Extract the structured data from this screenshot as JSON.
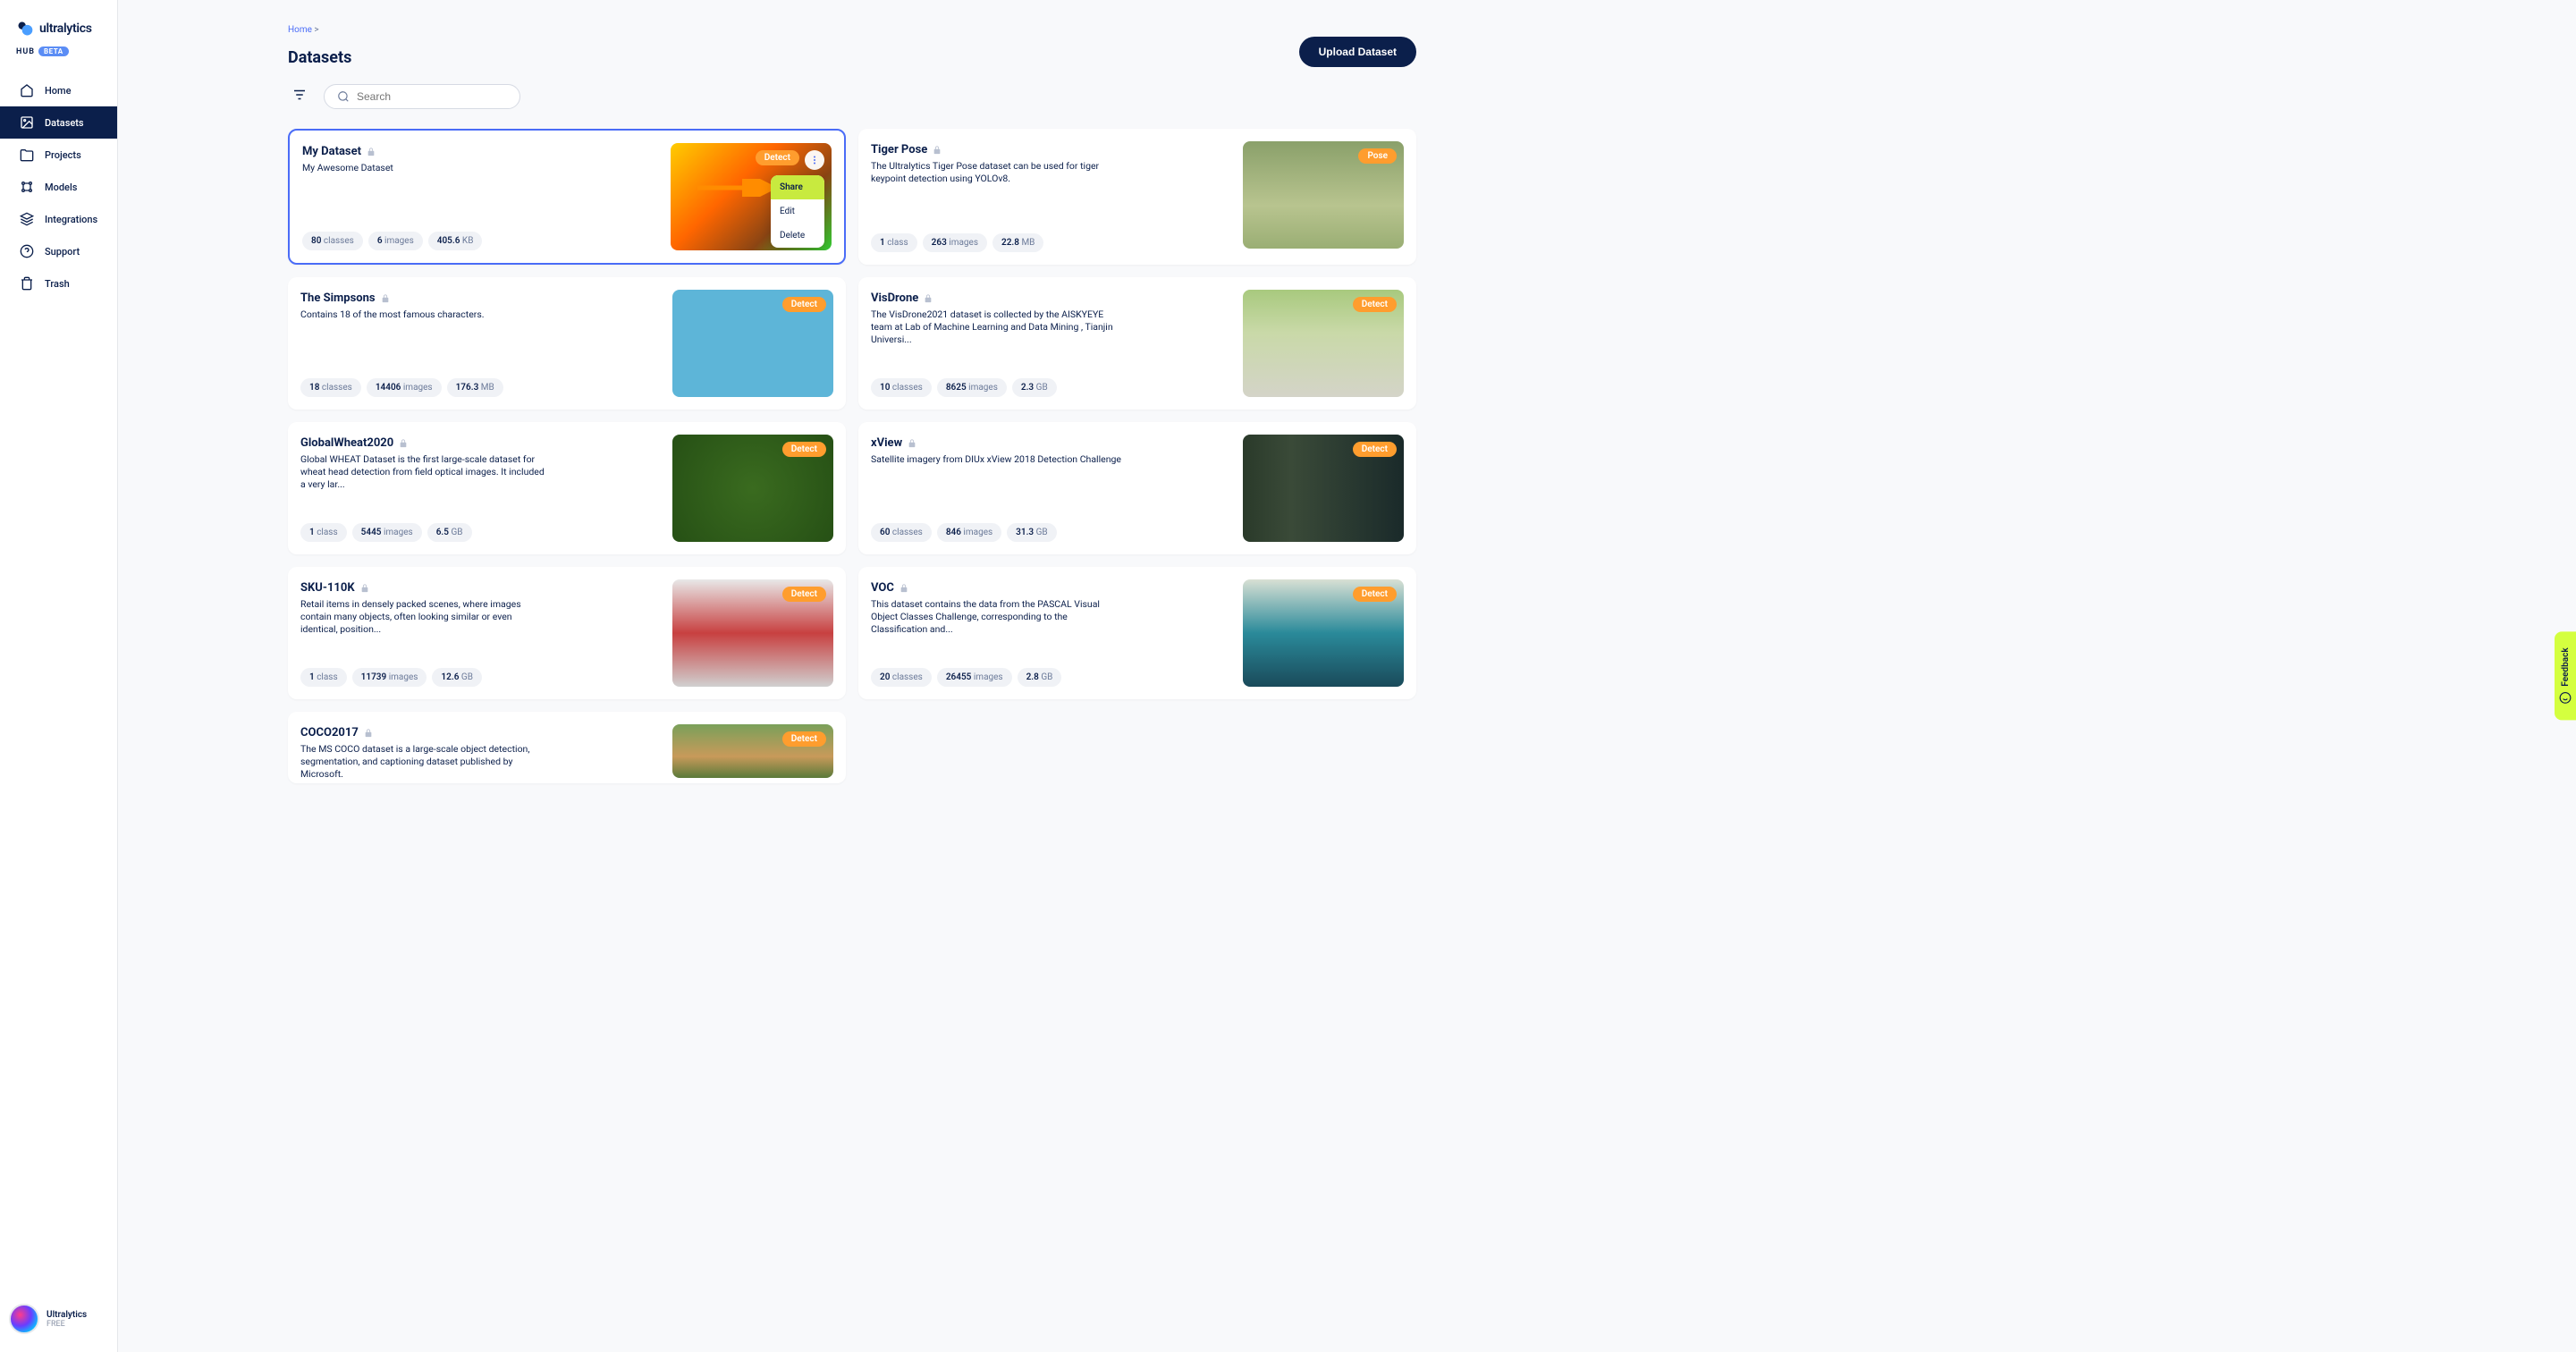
{
  "brand": {
    "name": "ultralytics",
    "hub": "HUB",
    "beta": "BETA"
  },
  "nav": {
    "home": "Home",
    "datasets": "Datasets",
    "projects": "Projects",
    "models": "Models",
    "integrations": "Integrations",
    "support": "Support",
    "trash": "Trash"
  },
  "user": {
    "name": "Ultralytics",
    "plan": "FREE"
  },
  "breadcrumb": {
    "home": "Home",
    "sep": ">"
  },
  "page": {
    "title": "Datasets"
  },
  "actions": {
    "upload": "Upload Dataset"
  },
  "search": {
    "placeholder": "Search"
  },
  "labels": {
    "classes": "classes",
    "class": "class",
    "images": "images",
    "kb": "KB",
    "mb": "MB",
    "gb": "GB"
  },
  "popup": {
    "share": "Share",
    "edit": "Edit",
    "delete": "Delete"
  },
  "feedback": "Feedback",
  "cards": [
    {
      "title": "My Dataset",
      "desc": "My Awesome Dataset",
      "badge": "Detect",
      "classes": "80",
      "class_unit": "classes",
      "images": "6",
      "size": "405.6",
      "size_unit": "KB",
      "selected": true,
      "menu": true,
      "thumb": "thumb-mydataset"
    },
    {
      "title": "Tiger Pose",
      "desc": "The Ultralytics Tiger Pose dataset can be used for tiger keypoint detection using YOLOv8.",
      "badge": "Pose",
      "classes": "1",
      "class_unit": "class",
      "images": "263",
      "size": "22.8",
      "size_unit": "MB",
      "thumb": "thumb-tiger"
    },
    {
      "title": "The Simpsons",
      "desc": "Contains 18 of the most famous characters.",
      "badge": "Detect",
      "classes": "18",
      "class_unit": "classes",
      "images": "14406",
      "size": "176.3",
      "size_unit": "MB",
      "thumb": "thumb-simpsons"
    },
    {
      "title": "VisDrone",
      "desc": "The VisDrone2021 dataset is collected by the AISKYEYE team at Lab of Machine Learning and Data Mining , Tianjin Universi...",
      "badge": "Detect",
      "classes": "10",
      "class_unit": "classes",
      "images": "8625",
      "size": "2.3",
      "size_unit": "GB",
      "thumb": "thumb-visdrone"
    },
    {
      "title": "GlobalWheat2020",
      "desc": "Global WHEAT Dataset is the first large-scale dataset for wheat head detection from field optical images. It included a very lar...",
      "badge": "Detect",
      "classes": "1",
      "class_unit": "class",
      "images": "5445",
      "size": "6.5",
      "size_unit": "GB",
      "thumb": "thumb-wheat"
    },
    {
      "title": "xView",
      "desc": "Satellite imagery from DIUx xView 2018 Detection Challenge",
      "badge": "Detect",
      "classes": "60",
      "class_unit": "classes",
      "images": "846",
      "size": "31.3",
      "size_unit": "GB",
      "thumb": "thumb-xview"
    },
    {
      "title": "SKU-110K",
      "desc": "Retail items in densely packed scenes, where images contain many objects, often looking similar or even identical, position...",
      "badge": "Detect",
      "classes": "1",
      "class_unit": "class",
      "images": "11739",
      "size": "12.6",
      "size_unit": "GB",
      "thumb": "thumb-sku"
    },
    {
      "title": "VOC",
      "desc": "This dataset contains the data from the PASCAL Visual Object Classes Challenge, corresponding to the Classification and...",
      "badge": "Detect",
      "classes": "20",
      "class_unit": "classes",
      "images": "26455",
      "size": "2.8",
      "size_unit": "GB",
      "thumb": "thumb-voc"
    },
    {
      "title": "COCO2017",
      "desc": "The MS COCO dataset is a large-scale object detection, segmentation, and captioning dataset published by Microsoft.",
      "badge": "Detect",
      "thumb": "thumb-coco",
      "partial": true
    }
  ]
}
